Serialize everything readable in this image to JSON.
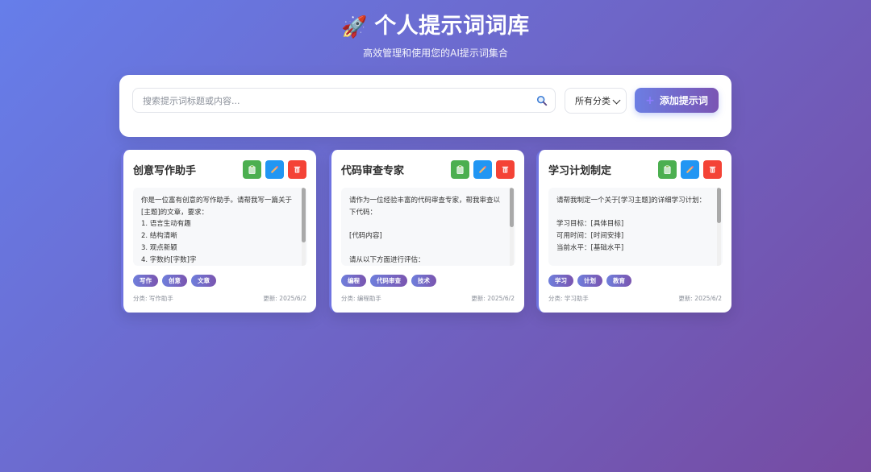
{
  "header": {
    "icon": "rocket-icon",
    "title": "个人提示词词库",
    "subtitle": "高效管理和使用您的AI提示词集合"
  },
  "toolbar": {
    "search_placeholder": "搜索提示词标题或内容...",
    "category_selected": "所有分类",
    "add_label": "添加提示词"
  },
  "cards": [
    {
      "title": "创意写作助手",
      "content": "你是一位富有创意的写作助手。请帮我写一篇关于[主题]的文章，要求：\n1. 语言生动有趣\n2. 结构清晰\n3. 观点新颖\n4. 字数约[字数]字",
      "tags": [
        "写作",
        "创意",
        "文章"
      ],
      "category": "分类: 写作助手",
      "updated": "更新: 2025/6/2",
      "scroll_visible_fraction": 0.7
    },
    {
      "title": "代码审查专家",
      "content": "请作为一位经验丰富的代码审查专家，帮我审查以下代码：\n\n[代码内容]\n\n请从以下方面进行评估：",
      "tags": [
        "编程",
        "代码审查",
        "技术"
      ],
      "category": "分类: 编程助手",
      "updated": "更新: 2025/6/2",
      "scroll_visible_fraction": 0.5
    },
    {
      "title": "学习计划制定",
      "content": "请帮我制定一个关于[学习主题]的详细学习计划：\n\n学习目标：[具体目标]\n可用时间：[时间安排]\n当前水平：[基础水平]",
      "tags": [
        "学习",
        "计划",
        "教育"
      ],
      "category": "分类: 学习助手",
      "updated": "更新: 2025/6/2",
      "scroll_visible_fraction": 0.45
    }
  ],
  "colors": {
    "bg_start": "#667eea",
    "bg_end": "#764ba2",
    "copy": "#4caf50",
    "edit": "#2196f3",
    "delete": "#f44336"
  }
}
